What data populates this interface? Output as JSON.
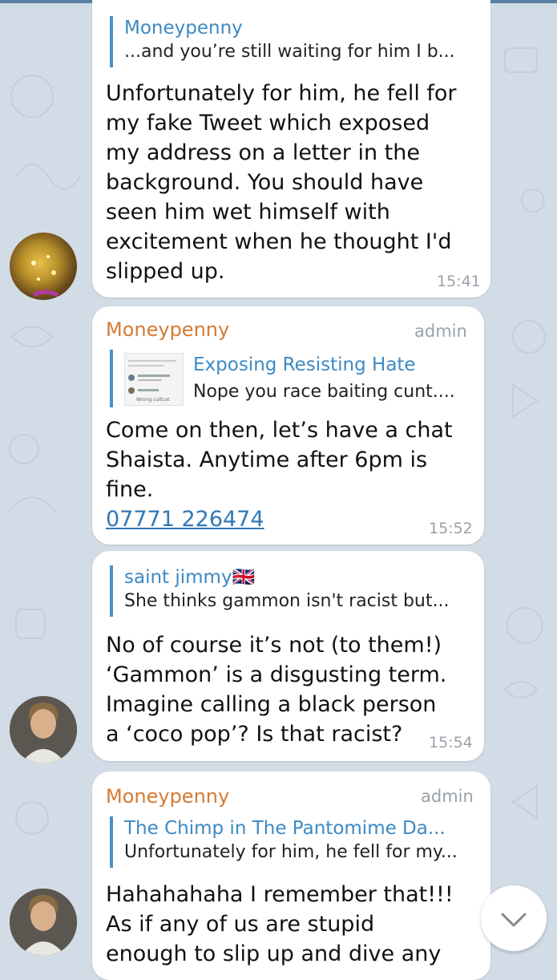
{
  "messages": [
    {
      "reply_name": "Moneypenny",
      "reply_text": "...and you’re still waiting for him I b...",
      "lines": [
        "Unfortunately for him, he fell for",
        "my fake Tweet which exposed",
        "my address on a letter in the",
        "background. You should have",
        "seen him wet himself with",
        "excitement when he thought I'd",
        "slipped up."
      ],
      "time": "15:41"
    },
    {
      "sender": "Moneypenny",
      "admin": "admin",
      "reply_name": "Exposing Resisting Hate",
      "reply_text": "Nope you race baiting cunt....",
      "thumb_caption": "Wrong cultcat",
      "lines": [
        "Come on then, let’s have a chat",
        "Shaista. Anytime after 6pm is",
        "fine."
      ],
      "phone": "07771 226474",
      "time": "15:52"
    },
    {
      "reply_name": "saint jimmy🇬🇧",
      "reply_text": "She thinks gammon isn't racist but...",
      "lines": [
        "No of course it’s not (to them!)",
        "‘Gammon’ is a disgusting term.",
        "Imagine calling a black person",
        "a ‘coco pop’? Is that racist?"
      ],
      "time": "15:54"
    },
    {
      "sender": "Moneypenny",
      "admin": "admin",
      "reply_name": "The Chimp in The Pantomime Da...",
      "reply_text": "Unfortunately for him, he fell for my...",
      "lines": [
        "Hahahahaha I remember that!!!",
        "As if any of us are stupid",
        "enough to slip up and dive any"
      ]
    }
  ],
  "colors": {
    "background": "#d2dce6",
    "bubble": "#ffffff",
    "sender": "#d47a33",
    "reply_bar": "#4a90c7",
    "link": "#2f78b7"
  },
  "icons": {
    "scroll_down": "chevron-down-icon"
  }
}
